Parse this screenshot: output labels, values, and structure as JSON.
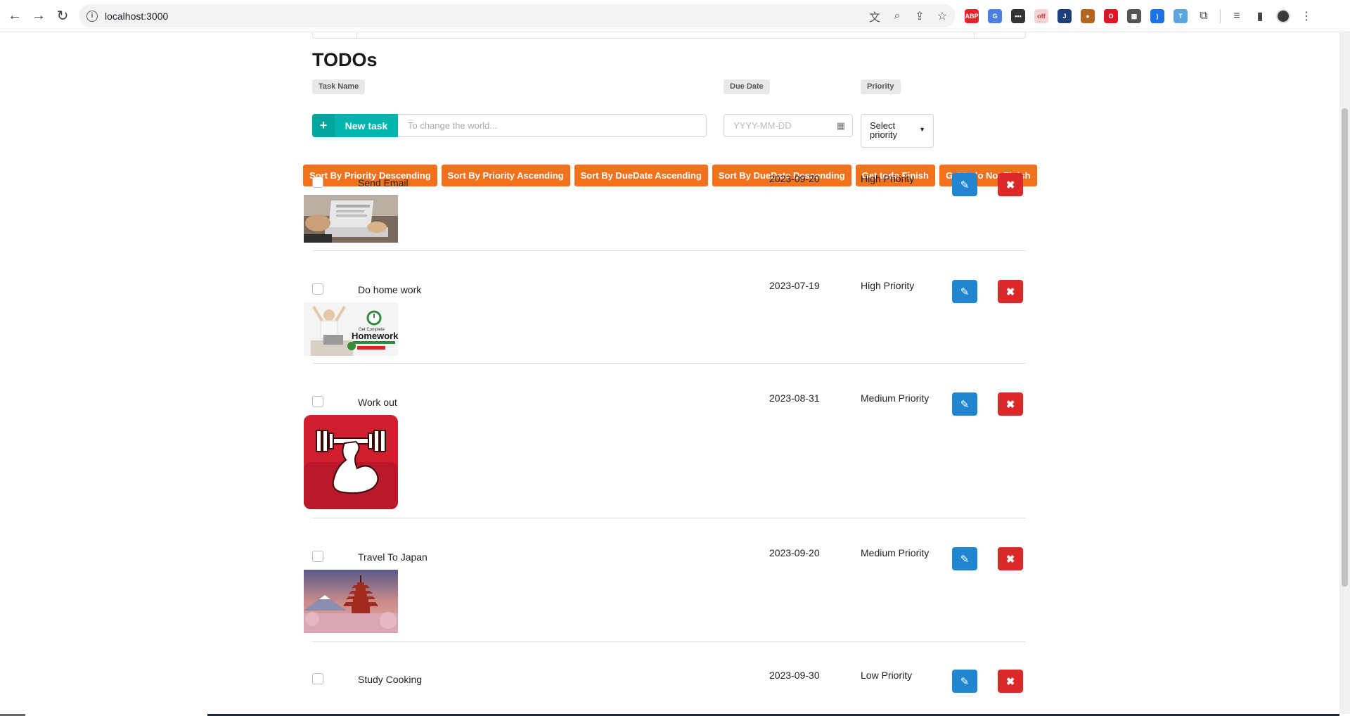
{
  "browser": {
    "url": "localhost:3000",
    "extensions": [
      {
        "icon": "adblock-icon",
        "text": "ABP",
        "color": "#e3242b"
      },
      {
        "icon": "translate-ext-icon",
        "text": "G",
        "color": "#4a7fe0"
      },
      {
        "icon": "dots-ext-icon",
        "text": "•••",
        "color": "#333333"
      },
      {
        "icon": "red-ext-icon",
        "text": "off",
        "color": "#f6d3d3"
      },
      {
        "icon": "j-ext-icon",
        "text": "J",
        "color": "#1c3f7a"
      },
      {
        "icon": "cookie-ext-icon",
        "text": "●",
        "color": "#b5651d"
      },
      {
        "icon": "opera-ext-icon",
        "text": "O",
        "color": "#e01626"
      },
      {
        "icon": "qr-ext-icon",
        "text": "▦",
        "color": "#555555"
      },
      {
        "icon": "wave-ext-icon",
        "text": ")",
        "color": "#1a73e8"
      },
      {
        "icon": "blue-ext-icon",
        "text": "T",
        "color": "#5ba6e0"
      }
    ]
  },
  "app": {
    "title": "TODOs",
    "labels": {
      "task_name": "Task Name",
      "due_date": "Due Date",
      "priority": "Priority"
    },
    "new_task_label": "New task",
    "task_placeholder": "To change the world...",
    "date_placeholder": "YYYY-MM-DD",
    "priority_select": "Select priority",
    "sort_buttons": [
      "Sort By Priority Descending",
      "Sort By Priority Ascending",
      "Sort By DueDate Ascending",
      "Sort By DueDate Descending",
      "Get todo Finish",
      "Get todo Not Finish"
    ],
    "todos": [
      {
        "name": "Send Email",
        "date": "2023-09-20",
        "priority": "High Priority",
        "image": "laptop-typing-photo",
        "checked": false
      },
      {
        "name": "Do home work",
        "date": "2023-07-19",
        "priority": "High Priority",
        "image": "homework-banner-photo",
        "checked": false
      },
      {
        "name": "Work out",
        "date": "2023-08-31",
        "priority": "Medium Priority",
        "image": "dumbbell-arm-icon",
        "checked": false
      },
      {
        "name": "Travel To Japan",
        "date": "2023-09-20",
        "priority": "Medium Priority",
        "image": "japan-pagoda-photo",
        "checked": false
      },
      {
        "name": "Study Cooking",
        "date": "2023-09-30",
        "priority": "Low Priority",
        "image": "",
        "checked": false
      }
    ],
    "homework_banner_text": "Homework",
    "homework_banner_small": "Get Complete"
  },
  "colors": {
    "teal": "#00b5ad",
    "orange": "#f2711c",
    "blue": "#2185d0",
    "red": "#db2828"
  }
}
